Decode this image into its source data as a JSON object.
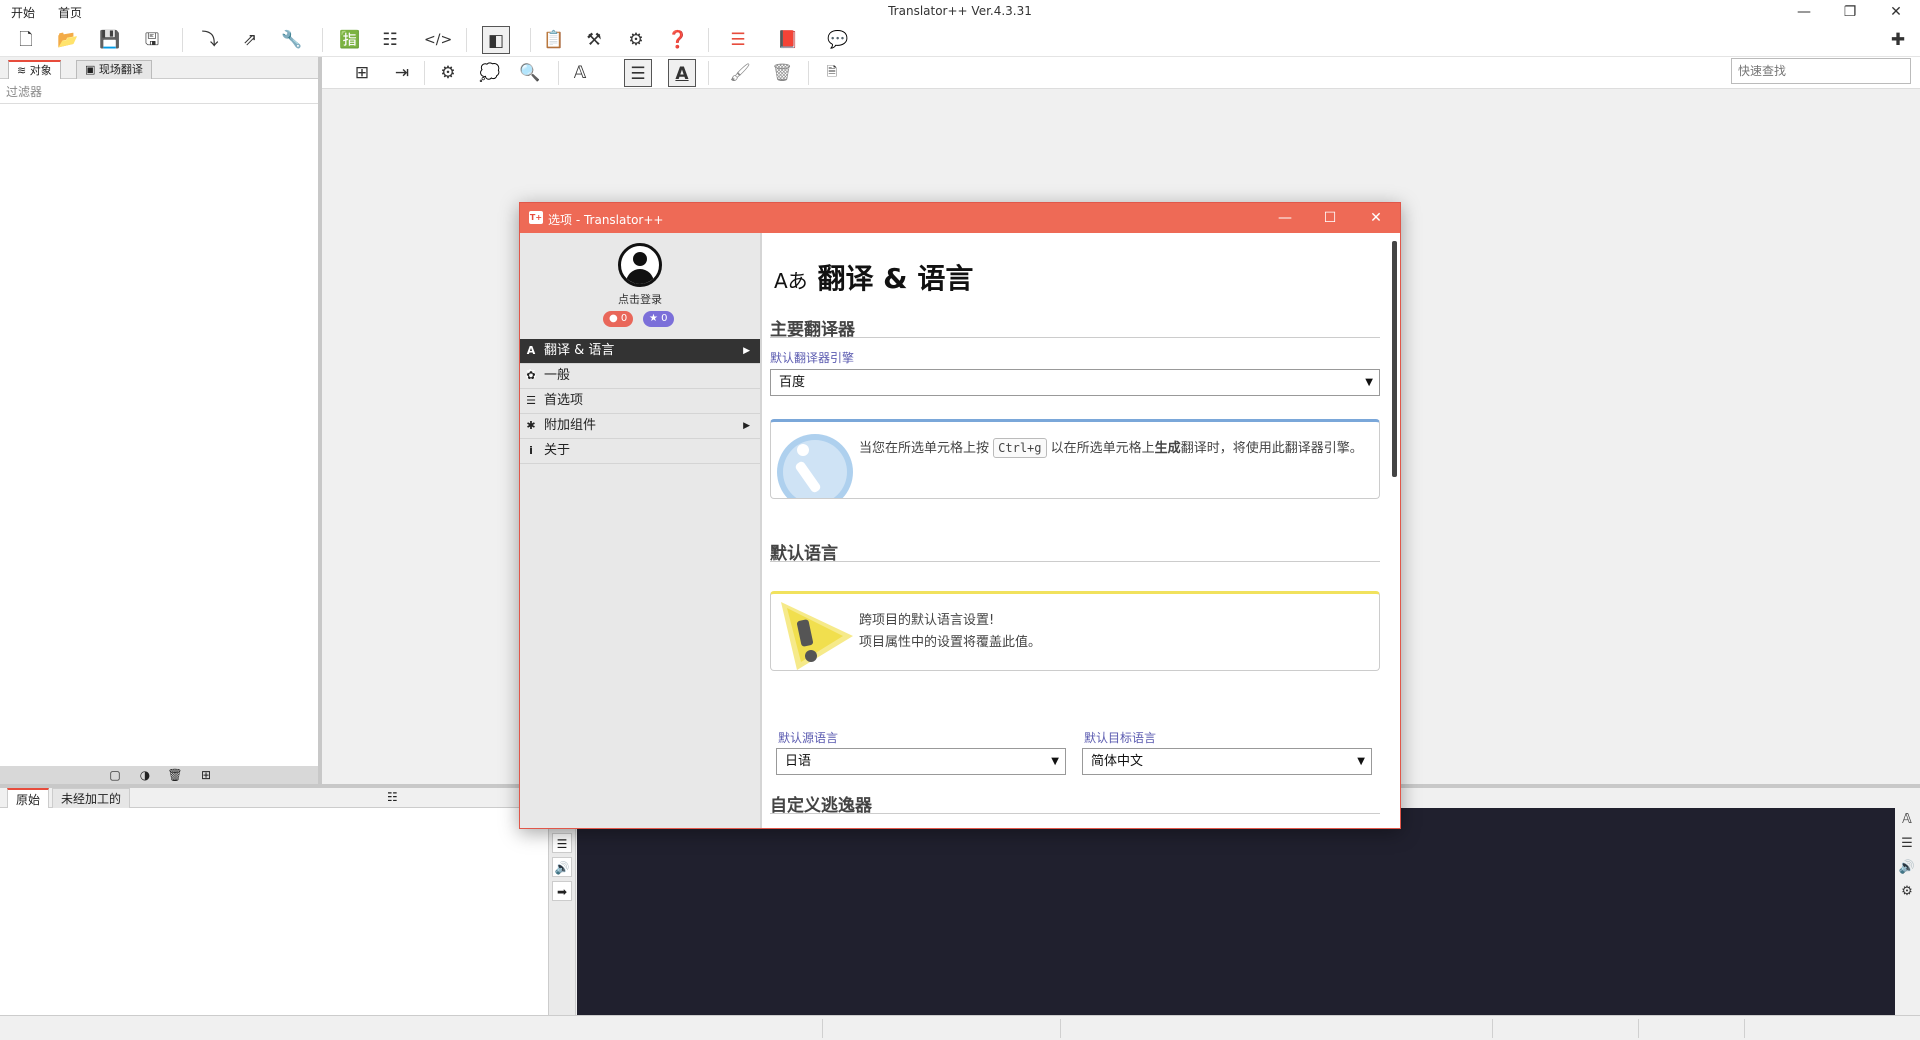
{
  "app": {
    "title": "Translator++ Ver.4.3.31",
    "menu": [
      "开始",
      "首页"
    ]
  },
  "quick_search": {
    "placeholder": "快速查找"
  },
  "left_panel": {
    "tabs": [
      {
        "icon": "≋",
        "label": "对象"
      },
      {
        "icon": "▣",
        "label": "现场翻译"
      }
    ],
    "filter_label": "过滤器"
  },
  "bottom": {
    "tabs": [
      "原始",
      "未经加工的"
    ]
  },
  "dialog": {
    "title": "选项 - Translator++",
    "login_text": "点击登录",
    "badges": [
      {
        "icon": "●",
        "value": "0",
        "color": "#e9675a"
      },
      {
        "icon": "★",
        "value": "0",
        "color": "#7b6fd9"
      }
    ],
    "nav": [
      {
        "icon": "Aあ",
        "label": "翻译 & 语言",
        "arrow": "▶"
      },
      {
        "icon": "✿",
        "label": "一般",
        "arrow": ""
      },
      {
        "icon": "☰",
        "label": "首选项",
        "arrow": ""
      },
      {
        "icon": "✱",
        "label": "附加组件",
        "arrow": "▶"
      },
      {
        "icon": "i",
        "label": "关于",
        "arrow": ""
      }
    ],
    "content": {
      "heading_icon": "Aあ",
      "heading": "翻译 & 语言",
      "section_main_translator": "主要翻译器",
      "default_engine_label": "默认翻译器引擎",
      "default_engine_value": "百度",
      "info_text_1": "当您在所选单元格上按",
      "info_kbd": "Ctrl+g",
      "info_text_2": "以在所选单元格上",
      "info_bold": "生成",
      "info_text_3": "翻译时，将使用此翻译器引擎。",
      "section_default_language": "默认语言",
      "warn_line1": "跨项目的默认语言设置!",
      "warn_line2": "项目属性中的设置将覆盖此值。",
      "source_label": "默认源语言",
      "source_value": "日语",
      "target_label": "默认目标语言",
      "target_value": "简体中文",
      "section_custom_escaper": "自定义逃逸器"
    }
  },
  "colors": {
    "accent": "#ee6a56",
    "editor_bg": "#20202e",
    "nav_active": "#333333"
  }
}
